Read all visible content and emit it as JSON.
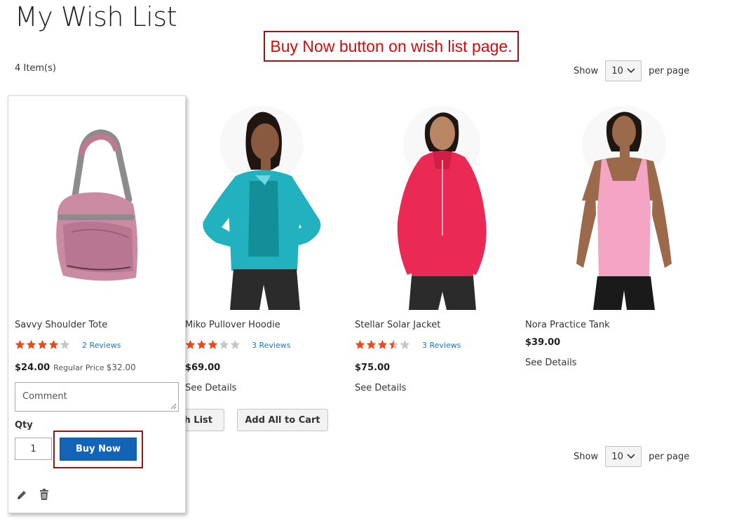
{
  "page": {
    "title": "My Wish List",
    "annotation": "Buy Now button on wish list page.",
    "item_count": "4 Item(s)"
  },
  "toolbar": {
    "show_label": "Show",
    "limit_value": "10",
    "per_page_label": "per page"
  },
  "products": [
    {
      "name": "Savvy Shoulder Tote",
      "rating_stars": 4,
      "reviews": "2 Reviews",
      "price": "$24.00",
      "regular_label": "Regular Price",
      "regular_price": "$32.00",
      "comment_placeholder": "Comment",
      "qty_label": "Qty",
      "qty_value": "1",
      "buy_label": "Buy Now",
      "image_icon": "pink-tote-bag"
    },
    {
      "name": "Miko Pullover Hoodie",
      "rating_stars": 3,
      "reviews": "3 Reviews",
      "price": "$69.00",
      "details": "See Details",
      "image_icon": "teal-hoodie"
    },
    {
      "name": "Stellar Solar Jacket",
      "rating_stars": 3.5,
      "reviews": "3 Reviews",
      "price": "$75.00",
      "details": "See Details",
      "image_icon": "pink-jacket"
    },
    {
      "name": "Nora Practice Tank",
      "price": "$39.00",
      "details": "See Details",
      "image_icon": "pink-tank-top"
    }
  ],
  "actions": {
    "share_partial": "h List",
    "add_all_label": "Add All to Cart"
  },
  "colors": {
    "star": "#e84c1a",
    "star_empty": "#c7c7c7",
    "link": "#1979c3",
    "primary": "#1363b7",
    "annotation_border": "#8b1a1a",
    "annotation_text": "#d20b0b"
  },
  "icons": {
    "edit": "pencil-icon",
    "remove": "trash-icon",
    "chevron": "chevron-down-icon"
  }
}
